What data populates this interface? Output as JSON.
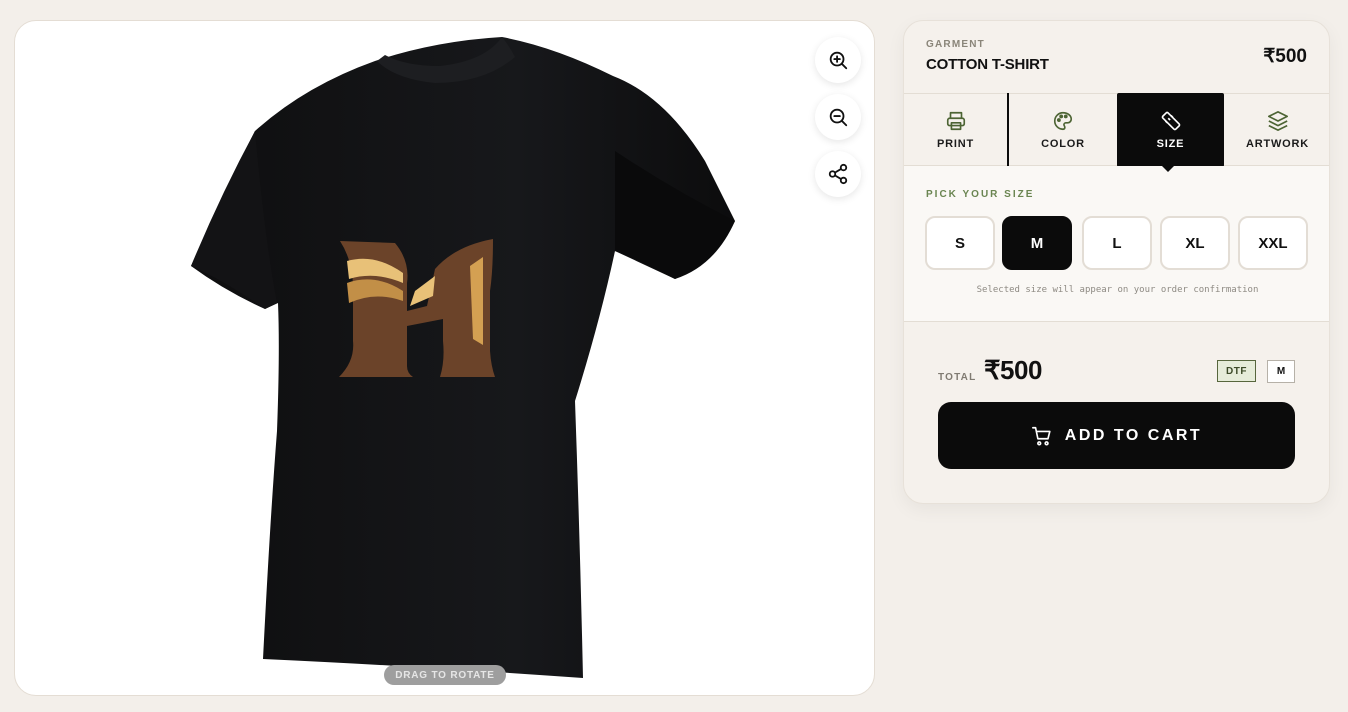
{
  "viewer": {
    "drag_hint": "DRAG TO ROTATE",
    "tools": [
      {
        "name": "zoom-in",
        "icon": "zoom-in-icon"
      },
      {
        "name": "zoom-out",
        "icon": "zoom-out-icon"
      },
      {
        "name": "share",
        "icon": "share-icon"
      }
    ],
    "colors": {
      "shirt": "#111214",
      "logo_brown": "#6b4329",
      "logo_gold": "#d4a052"
    }
  },
  "garment": {
    "label": "GARMENT",
    "name": "COTTON T-SHIRT",
    "price": "₹500"
  },
  "tabs": [
    {
      "label": "PRINT",
      "icon": "printer-icon",
      "active": false
    },
    {
      "label": "COLOR",
      "icon": "palette-icon",
      "active": false
    },
    {
      "label": "SIZE",
      "icon": "ruler-icon",
      "active": true
    },
    {
      "label": "ARTWORK",
      "icon": "layers-icon",
      "active": false
    }
  ],
  "size_picker": {
    "label": "PICK YOUR SIZE",
    "options": [
      "S",
      "M",
      "L",
      "XL",
      "XXL"
    ],
    "selected": "M",
    "note": "Selected size will appear on your order confirmation"
  },
  "summary": {
    "total_label": "TOTAL",
    "total_value": "₹500",
    "print_badge": "DTF",
    "size_badge": "M"
  },
  "cart_button": {
    "label": "ADD TO CART",
    "icon": "cart-icon"
  },
  "accent_colors": {
    "dark": "#0b0b0b",
    "olive": "#6a8551",
    "panel": "#f5f1ec"
  }
}
